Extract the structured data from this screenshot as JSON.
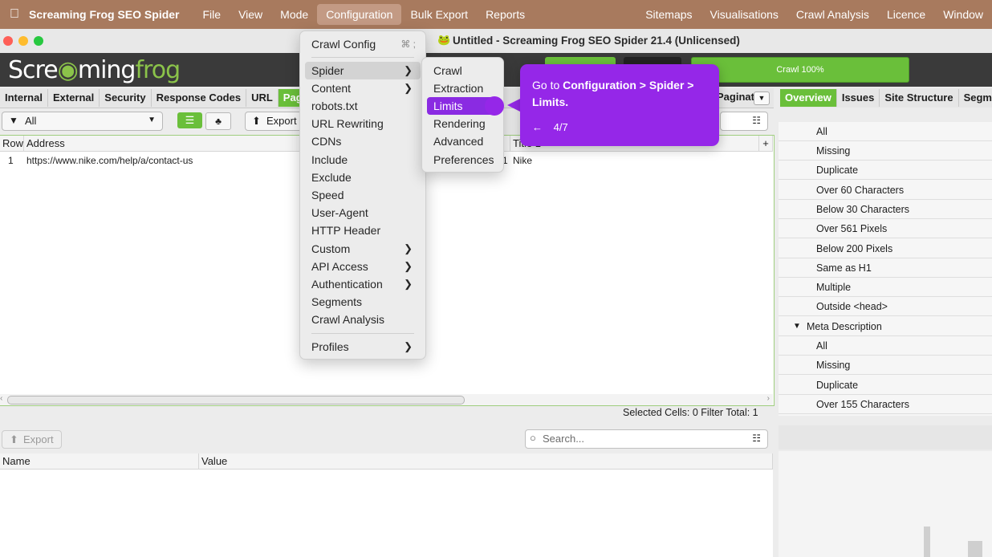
{
  "menubar": {
    "app_name": "Screaming Frog SEO Spider",
    "left_items": [
      "File",
      "View",
      "Mode",
      "Configuration",
      "Bulk Export",
      "Reports"
    ],
    "right_items": [
      "Sitemaps",
      "Visualisations",
      "Crawl Analysis",
      "Licence",
      "Window"
    ]
  },
  "window": {
    "title": "Untitled - Screaming Frog SEO Spider 21.4 (Unlicensed)"
  },
  "brand": {
    "logo_left": "Scre",
    "logo_mid": "ming",
    "logo_right": "frog",
    "crawl_progress": "Crawl 100%",
    "crawl_progress_value": 1.0
  },
  "tabs": [
    "Internal",
    "External",
    "Security",
    "Response Codes",
    "URL",
    "Page"
  ],
  "right_tabs": [
    "Overview",
    "Issues",
    "Site Structure",
    "Segme"
  ],
  "pagination_label": "Paginat",
  "filter": {
    "value": "All",
    "export_label": "Export"
  },
  "table": {
    "headers": {
      "row": "Row",
      "address": "Address",
      "title": "Title 1"
    },
    "rows": [
      {
        "row": "1",
        "address": "https://www.nike.com/help/a/contact-us",
        "occurrences": "1",
        "title": "Nike"
      }
    ]
  },
  "status": {
    "selected_cells": "Selected Cells:  0",
    "filter_total": "Filter Total:  1"
  },
  "overview": {
    "items": [
      "All",
      "Missing",
      "Duplicate",
      "Over 60 Characters",
      "Below 30 Characters",
      "Over 561 Pixels",
      "Below 200 Pixels",
      "Same as H1",
      "Multiple",
      "Outside <head>"
    ],
    "group2_label": "Meta Description",
    "group2_items": [
      "All",
      "Missing",
      "Duplicate",
      "Over 155 Characters"
    ]
  },
  "bottom": {
    "export_label": "Export",
    "search_placeholder": "Search...",
    "headers": {
      "name": "Name",
      "value": "Value"
    }
  },
  "config_menu": {
    "crawl_config": "Crawl Config",
    "shortcut": "⌘ ;",
    "items": [
      "Spider",
      "Content",
      "robots.txt",
      "URL Rewriting",
      "CDNs",
      "Include",
      "Exclude",
      "Speed",
      "User-Agent",
      "HTTP Header",
      "Custom",
      "API Access",
      "Authentication",
      "Segments",
      "Crawl Analysis"
    ],
    "profiles": "Profiles"
  },
  "spider_submenu": {
    "items": [
      "Crawl",
      "Extraction",
      "Limits",
      "Rendering",
      "Advanced",
      "Preferences"
    ]
  },
  "tooltip": {
    "text_prefix": "Go to ",
    "text_bold": "Configuration > Spider > Limits.",
    "back_arrow": "←",
    "step": "4/7"
  },
  "colors": {
    "menubar": "#a87a5e",
    "accent_green": "#6abf3a",
    "tooltip_purple": "#9527e8"
  }
}
